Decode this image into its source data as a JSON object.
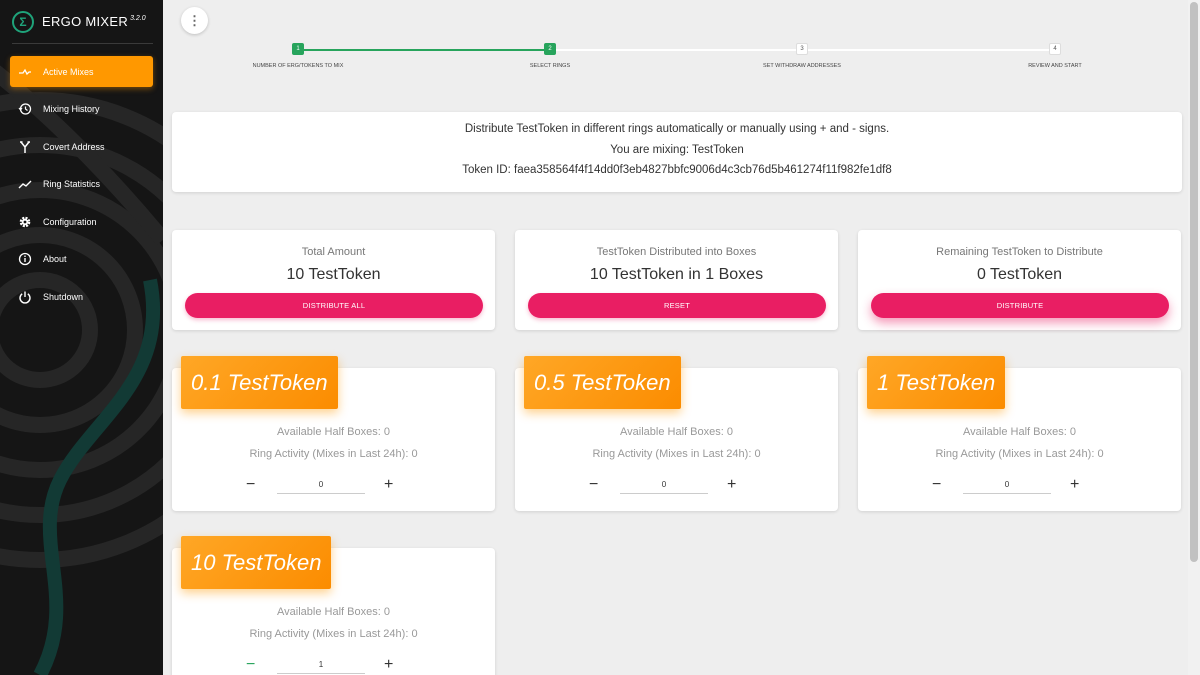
{
  "sidebar": {
    "brand": "ERGO MIXER",
    "version": "3.2.0",
    "items": [
      {
        "label": "Active Mixes",
        "icon": "active-mixes-icon"
      },
      {
        "label": "Mixing History",
        "icon": "history-icon"
      },
      {
        "label": "Covert Address",
        "icon": "covert-icon"
      },
      {
        "label": "Ring Statistics",
        "icon": "chart-line-icon"
      },
      {
        "label": "Configuration",
        "icon": "gear-icon"
      },
      {
        "label": "About",
        "icon": "info-icon"
      },
      {
        "label": "Shutdown",
        "icon": "power-icon"
      }
    ],
    "active_index": 0
  },
  "stepper": {
    "steps": [
      {
        "num": "1",
        "label": "NUMBER OF ERG/TOKENS TO MIX",
        "done": true
      },
      {
        "num": "2",
        "label": "SELECT RINGS",
        "done": true
      },
      {
        "num": "3",
        "label": "SET WITHDRAW ADDRESSES",
        "done": false
      },
      {
        "num": "4",
        "label": "REVIEW AND START",
        "done": false
      }
    ]
  },
  "info": {
    "line1": "Distribute TestToken in different rings automatically or manually using + and - signs.",
    "line2": "You are mixing: TestToken",
    "line3": "Token ID: faea358564f4f14dd0f3eb4827bbfc9006d4c3cb76d5b461274f11f982fe1df8"
  },
  "stats": {
    "total": {
      "label": "Total Amount",
      "value": "10 TestToken",
      "button": "DISTRIBUTE ALL"
    },
    "distributed": {
      "label": "TestToken Distributed into Boxes",
      "value": "10 TestToken in 1 Boxes",
      "button": "RESET"
    },
    "remaining": {
      "label": "Remaining TestToken to Distribute",
      "value": "0 TestToken",
      "button": "DISTRIBUTE"
    }
  },
  "rings": [
    {
      "title": "0.1 TestToken",
      "half_boxes": "Available Half Boxes: 0",
      "activity": "Ring Activity (Mixes in Last 24h): 0",
      "quantity": "0"
    },
    {
      "title": "0.5 TestToken",
      "half_boxes": "Available Half Boxes: 0",
      "activity": "Ring Activity (Mixes in Last 24h): 0",
      "quantity": "0"
    },
    {
      "title": "1 TestToken",
      "half_boxes": "Available Half Boxes: 0",
      "activity": "Ring Activity (Mixes in Last 24h): 0",
      "quantity": "0"
    },
    {
      "title": "10 TestToken",
      "half_boxes": "Available Half Boxes: 0",
      "activity": "Ring Activity (Mixes in Last 24h): 0",
      "quantity": "1"
    }
  ],
  "controls": {
    "minus": "−",
    "plus": "+"
  },
  "colors": {
    "accent": "#ff9800",
    "pink": "#e91e63",
    "green": "#27a45c",
    "sidebar": "#151515"
  }
}
